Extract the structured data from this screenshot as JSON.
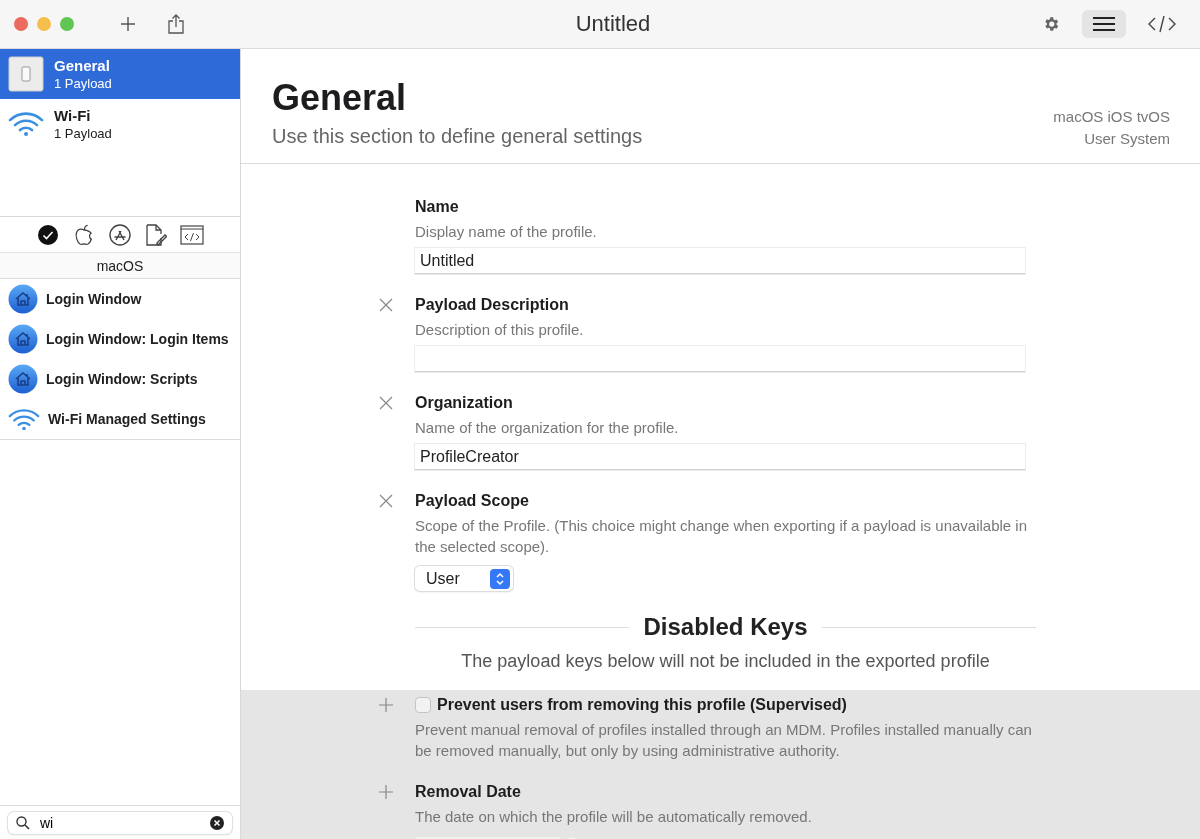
{
  "window": {
    "title": "Untitled"
  },
  "payloads": [
    {
      "kind": "general",
      "name": "General",
      "count": "1 Payload",
      "selected": true
    },
    {
      "kind": "wifi",
      "name": "Wi-Fi",
      "count": "1 Payload",
      "selected": false
    }
  ],
  "library": {
    "filters": [
      {
        "kind": "check",
        "selected": true
      },
      {
        "kind": "apple",
        "selected": false
      },
      {
        "kind": "appstore",
        "selected": false
      },
      {
        "kind": "document",
        "selected": false
      },
      {
        "kind": "code",
        "selected": false
      }
    ],
    "heading": "macOS",
    "items": [
      {
        "kind": "login",
        "name": "Login Window"
      },
      {
        "kind": "login",
        "name": "Login Window: Login Items"
      },
      {
        "kind": "login",
        "name": "Login Window: Scripts"
      },
      {
        "kind": "wifi",
        "name": "Wi-Fi Managed Settings"
      }
    ]
  },
  "search": {
    "value": "wi"
  },
  "header": {
    "title": "General",
    "subtitle": "Use this section to define general settings",
    "platforms": "macOS iOS tvOS",
    "scopes": "User System"
  },
  "settings": [
    {
      "kind": "text",
      "removable": false,
      "label": "Name",
      "description": "Display name of the profile.",
      "value": "Untitled"
    },
    {
      "kind": "text",
      "removable": true,
      "label": "Payload Description",
      "description": "Description of this profile."
    },
    {
      "kind": "text",
      "removable": true,
      "label": "Organization",
      "description": "Name of the organization for the profile.",
      "value": "ProfileCreator"
    },
    {
      "kind": "popup",
      "removable": true,
      "label": "Payload Scope",
      "description": "Scope of the Profile. (This choice might change when exporting if a payload is unavailable in the selected scope).",
      "value": "User"
    }
  ],
  "disabled_keys": {
    "heading": "Disabled Keys",
    "note": "The payload keys below will not be included in the exported profile",
    "items": [
      {
        "kind": "checkbox",
        "checked": false,
        "label": "Prevent users from removing this profile (Supervised)",
        "description": "Prevent manual removal of profiles installed through an MDM. Profiles installed manually can be removed manually, but only by using administrative authority."
      },
      {
        "kind": "date",
        "label": "Removal Date",
        "description": "The date on which the profile will be automatically removed."
      }
    ]
  }
}
